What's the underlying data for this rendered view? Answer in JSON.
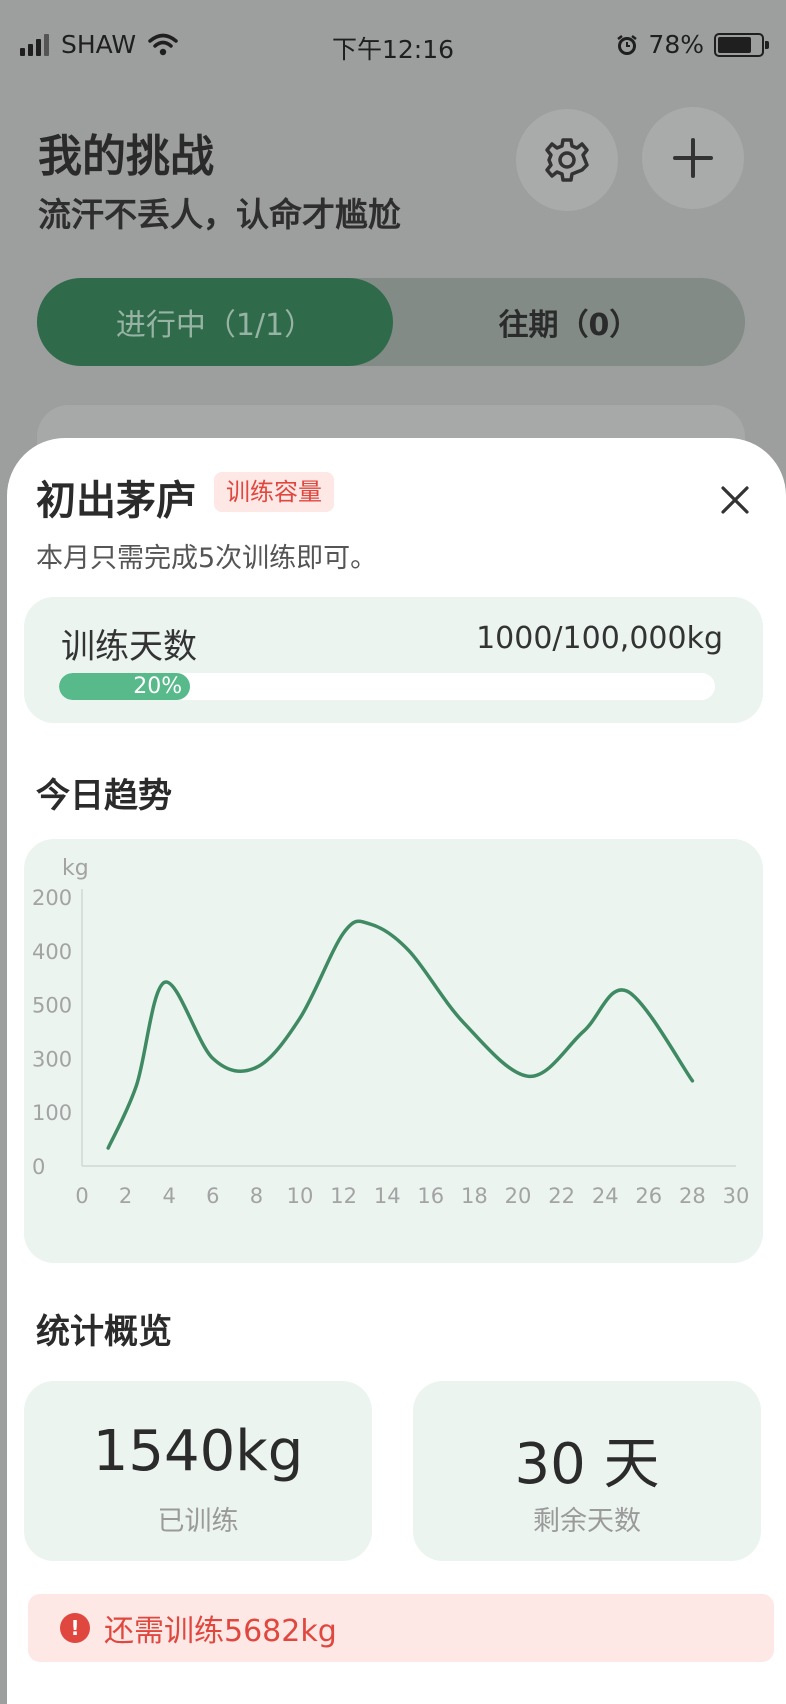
{
  "status_bar": {
    "carrier": "SHAW",
    "time": "下午12:16",
    "battery": "78%",
    "battery_level": 0.78
  },
  "header": {
    "title": "我的挑战",
    "subtitle": "流汗不丢人，认命才尴尬",
    "settings_icon": "gear-icon",
    "add_icon": "plus-icon"
  },
  "tabs": {
    "active": "进行中（1/1）",
    "inactive": "往期（0）"
  },
  "sheet": {
    "title": "初出茅庐",
    "tag": "训练容量",
    "description": "本月只需完成5次训练即可。",
    "progress": {
      "label": "训练天数",
      "value": "1000/100,000kg",
      "percent_label": "20%",
      "percent": 20
    },
    "trend_title": "今日趋势",
    "stats_title": "统计概览",
    "stats": [
      {
        "value": "1540kg",
        "label": "已训练"
      },
      {
        "value": "30 天",
        "label": "剩余天数"
      }
    ],
    "alert": {
      "icon": "!",
      "text": "还需训练5682kg"
    }
  },
  "colors": {
    "accent": "#2f6a4b",
    "line": "#3f8a63",
    "progress": "#58b98b",
    "card_bg": "#ebf4ef",
    "alert": "#e0473e",
    "alert_bg": "#fde8e6"
  },
  "chart_data": {
    "type": "line",
    "ylabel": "kg",
    "x_ticks": [
      0,
      2,
      4,
      6,
      8,
      10,
      12,
      14,
      16,
      18,
      20,
      22,
      24,
      26,
      28,
      30
    ],
    "y_ticks": [
      "200",
      "400",
      "500",
      "300",
      "100",
      "0"
    ],
    "series": [
      {
        "x": [
          1.2,
          2.5,
          3.8,
          6,
          8,
          10,
          12,
          13.2,
          15,
          17.5,
          20.5,
          23,
          25,
          28
        ],
        "y": [
          40,
          180,
          410,
          240,
          220,
          330,
          520,
          540,
          480,
          320,
          200,
          300,
          390,
          190
        ]
      }
    ],
    "ylim": [
      0,
      600
    ],
    "xlim": [
      0,
      30
    ],
    "grid": false
  }
}
